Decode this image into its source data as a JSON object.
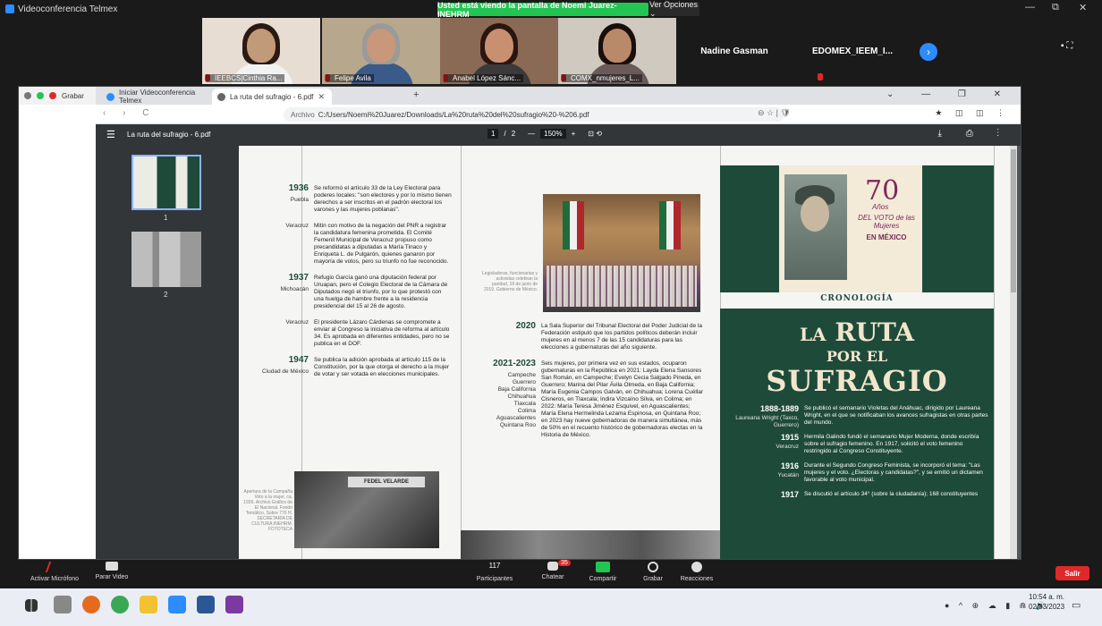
{
  "zoom": {
    "app_title": "Videoconferencia Telmex",
    "share_banner": "Usted está viendo la pantalla de Noemi Juarez-INEHRM",
    "view_options": "Ver Opciones ⌄",
    "window_controls": [
      "—",
      "⧉",
      "✕"
    ],
    "participants": [
      {
        "name": "IEEBCS|Cinthia Ra...",
        "colors": {
          "bg": "#e7ddd2",
          "skin": "#c19a7a",
          "hair": "#2a1a12",
          "shirt": "#f2f2f2"
        }
      },
      {
        "name": "Felipe Avila",
        "colors": {
          "bg": "#b7a78d",
          "skin": "#c9977a",
          "hair": "#9a9a9a",
          "shirt": "#3a5a8a"
        }
      },
      {
        "name": "Anabel López Sánc...",
        "colors": {
          "bg": "#8a6a55",
          "skin": "#c89070",
          "hair": "#2a1510",
          "shirt": "#3a3a3a"
        }
      },
      {
        "name": "COMX_nmujeres_L...",
        "colors": {
          "bg": "#cfc9c0",
          "skin": "#b98a6a",
          "hair": "#1a0e0a",
          "shirt": "#6a5a5a"
        }
      }
    ],
    "name_tiles": [
      "Nadine Gasman",
      "EDOMEX_IEEM_I..."
    ],
    "next_icon": "›",
    "top_right_icons": "▪ ⛶"
  },
  "browser": {
    "rec_label": "Grabar",
    "tabs": [
      {
        "label": "Iniciar Videoconferencia Telmex",
        "active": false,
        "icon_color": "#2d8cff"
      },
      {
        "label": "La ruta del sufragio - 6.pdf",
        "active": true,
        "icon_color": "#666666"
      }
    ],
    "tab_close": "✕",
    "new_tab": "+",
    "win_buttons": "⌄ — ❐ ✕",
    "nav": "‹ › C",
    "url_scheme": "Archivo",
    "url": "C:/Users/Noemi%20Juarez/Downloads/La%20ruta%20del%20sufragio%20-%206.pdf",
    "url_right_icons": "⊖ ☆ | 🛡",
    "ext_icons": "★ ◫ ◫ ⋮"
  },
  "pdf": {
    "menu_icon": "☰",
    "filename": "La ruta del sufragio - 6.pdf",
    "page_current": "1",
    "page_sep": "/",
    "page_total": "2",
    "zoom_minus": "—",
    "zoom": "150%",
    "zoom_plus": "+",
    "right_icons": "⤓ ⎙ ⋮",
    "thumb_labels": [
      "1",
      "2"
    ]
  },
  "doc": {
    "col1": [
      {
        "year": "1936",
        "place": "Puebla",
        "text": "Se reformó el artículo 33 de la Ley Electoral para poderes locales: \"son electores y por lo mismo tienen derechos a ser inscritos en el padrón electoral los varones y las mujeres poblanas\"."
      },
      {
        "year": "",
        "place": "Veracruz",
        "text": "Mitin con motivo de la negación del PNR a registrar la candidatura femenina prometida. El Comité Femenil Municipal de Veracruz propuso como precandidatas a diputadas a María Tinaco y Enriqueta L. de Pulgarón, quienes ganaron por mayoría de votos, pero su triunfo no fue reconocido."
      },
      {
        "year": "1937",
        "place": "Michoacán",
        "text": "Refugio García ganó una diputación federal por Uruapan, pero el Colegio Electoral de la Cámara de Diputados negó el triunfo, por lo que protestó con una huelga de hambre frente a la residencia presidencial del 15 al 26 de agosto."
      },
      {
        "year": "",
        "place": "Veracruz",
        "text": "El presidente Lázaro Cárdenas se compromete a enviar al Congreso la iniciativa de reforma al artículo 34. Es aprobada en diferentes entidades, pero no se publica en el DOF."
      },
      {
        "year": "1947",
        "place": "Ciudad de México",
        "text": "Se publica la adición aprobada al artículo 115 de la Constitución, por la que otorga el derecho a la mujer de votar y ser votada en elecciones municipales."
      }
    ],
    "caption_left": "Apertura de la Campaña Voto a la mujer, ca. 1935. Archivo Gráfico de El Nacional, Fondo Temático, Sobre 776 H. SECRETARÍA DE CULTURA.INEHRM. FOTOTECA",
    "photo_sign": "FEDEL VELARDE",
    "caption_mid": "Legisladoras, funcionarias y activistas celebran la paridad, 19 de junio de 2019. Gobierno de México.",
    "col2": [
      {
        "year": "2020",
        "place": "",
        "text": "La Sala Superior del Tribunal Electoral del Poder Judicial de la Federación estipuló que los partidos políticos deberán incluir mujeres en al menos 7 de las 15 candidaturas para las elecciones a gubernaturas del año siguiente."
      },
      {
        "year": "2021-2023",
        "place": "Campeche\nGuerrero\nBaja California\nChihuahua\nTlaxcala\nColima\nAguascalientes\nQuintana Roo",
        "text": "Seis mujeres, por primera vez en sus estados, ocuparon gubernaturas en la República en 2021: Layda Elena Sansores San Román, en Campeche; Evelyn Cecia Salgado Pineda, en Guerrero; Marina del Pilar Ávila Olmeda, en Baja California; María Eugenia Campos Galván, en Chihuahua; Lorena Cuéllar Cisneros, en Tlaxcala; Indira Vizcaíno Silva, en Colima; en 2022: María Teresa Jiménez Esquivel, en Aguascalientes; María Elena Hermelinda Lezama Espinosa, en Quintana Roo; en 2023 hay nueve gobernadoras de manera simultánea, más de 50% en el recuento histórico de gobernadoras electas en la Historia de México."
      }
    ],
    "cover": {
      "seventy": "70",
      "anos": "Años",
      "voto": "DEL VOTO de las Mujeres",
      "mexico": "EN MÉXICO",
      "cronologia": "CRONOLOGÍA",
      "title_la": "LA",
      "title_ruta": "RUTA",
      "title_por": "POR EL",
      "title_sufragio": "SUFRAGIO",
      "entries": [
        {
          "year": "1888-1889",
          "place": "Laureana Wright (Taxco, Guerrero)",
          "text": "Se publicó el semanario Violetas del Anáhuac, dirigido por Laureana Wright, en el que se notificaban los avances sufragistas en otras partes del mundo."
        },
        {
          "year": "1915",
          "place": "Veracruz",
          "text": "Hermila Galindo fundó el semanario Mujer Moderna, donde escribía sobre el sufragio femenino. En 1917, solicitó el voto femenino restringido al Congreso Constituyente."
        },
        {
          "year": "1916",
          "place": "Yucatán",
          "text": "Durante el Segundo Congreso Feminista, se incorporó el tema: \"Las mujeres y el voto. ¿Electoras y candidatas?\", y se emitió un dictamen favorable al voto municipal."
        },
        {
          "year": "1917",
          "place": "",
          "text": "Se discutió el artículo 34° (sobre la ciudadanía); 168 constituyentes"
        }
      ]
    }
  },
  "toolbar": {
    "mic": "Activar Micrófono",
    "video": "Parar Video",
    "participants_count": "117",
    "participants": "Participantes",
    "chat": "Chatear",
    "chat_badge": "35",
    "share": "Compartir",
    "record": "Grabar",
    "reactions": "Reacciones",
    "leave": "Salir"
  },
  "taskbar": {
    "tray": "● ^ ⊕ ☁ ▮ ⋒ 🔊",
    "time": "10:54 a. m.",
    "date": "02/03/2023",
    "apps": [
      {
        "name": "search-app-icon",
        "color": "#888888"
      },
      {
        "name": "edge-icon",
        "color": "#e56a1f"
      },
      {
        "name": "chrome-icon",
        "color": "#3aa757"
      },
      {
        "name": "files-icon",
        "color": "#f2c230"
      },
      {
        "name": "zoom-icon",
        "color": "#2d8cff"
      },
      {
        "name": "word-icon",
        "color": "#2b5797"
      },
      {
        "name": "onenote-icon",
        "color": "#7a3aa0"
      }
    ]
  }
}
